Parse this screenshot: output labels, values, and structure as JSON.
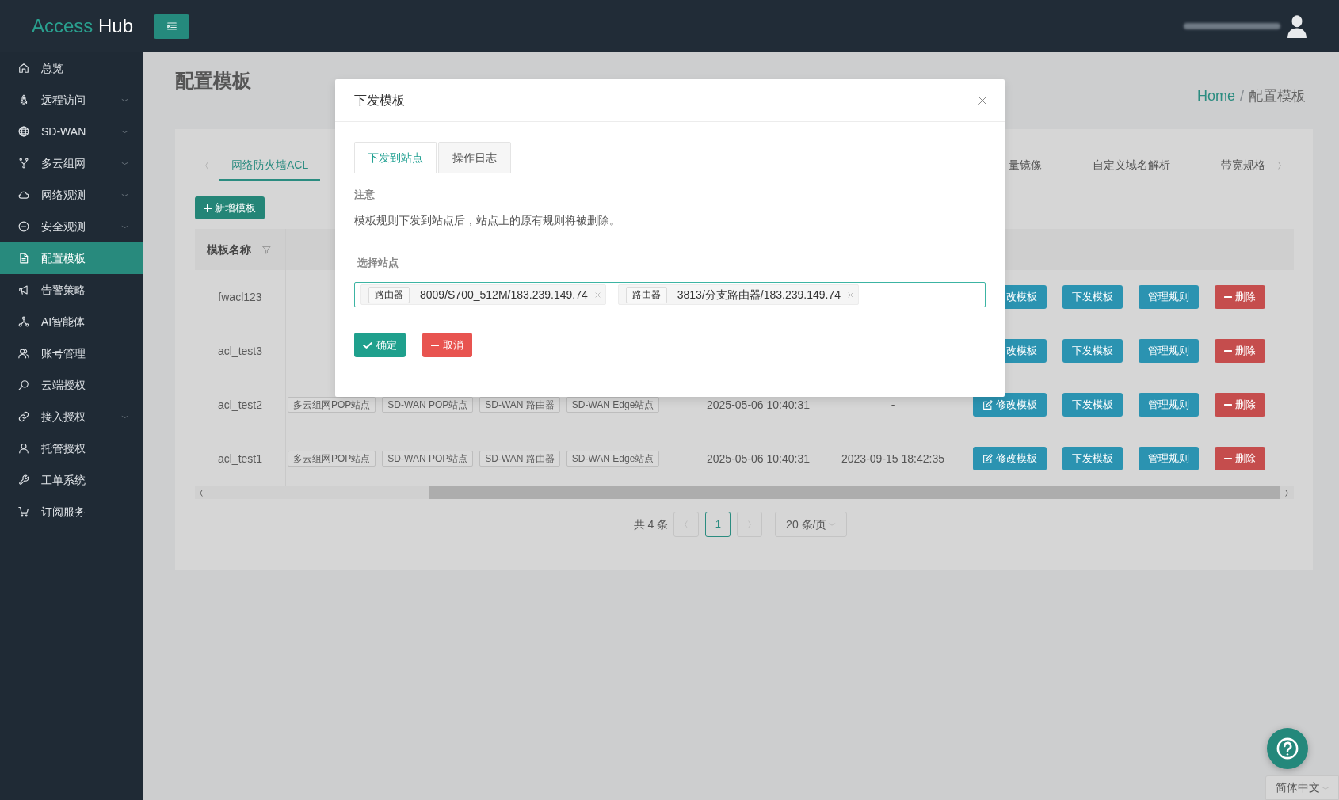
{
  "header": {
    "logo": {
      "first": "Access",
      "second": "Hub"
    }
  },
  "sidebar": {
    "items": [
      {
        "label": "总览",
        "expandable": false,
        "selected": false
      },
      {
        "label": "远程访问",
        "expandable": true,
        "selected": false
      },
      {
        "label": "SD-WAN",
        "expandable": true,
        "selected": false
      },
      {
        "label": "多云组网",
        "expandable": true,
        "selected": false
      },
      {
        "label": "网络观测",
        "expandable": true,
        "selected": false
      },
      {
        "label": "安全观测",
        "expandable": true,
        "selected": false
      },
      {
        "label": "配置模板",
        "expandable": false,
        "selected": true
      },
      {
        "label": "告警策略",
        "expandable": false,
        "selected": false
      },
      {
        "label": "AI智能体",
        "expandable": false,
        "selected": false
      },
      {
        "label": "账号管理",
        "expandable": false,
        "selected": false
      },
      {
        "label": "云端授权",
        "expandable": false,
        "selected": false
      },
      {
        "label": "接入授权",
        "expandable": true,
        "selected": false
      },
      {
        "label": "托管授权",
        "expandable": false,
        "selected": false
      },
      {
        "label": "工单系统",
        "expandable": false,
        "selected": false
      },
      {
        "label": "订阅服务",
        "expandable": false,
        "selected": false
      }
    ]
  },
  "page": {
    "title": "配置模板",
    "breadcrumb": {
      "separator": "/",
      "items": [
        {
          "label": "Home",
          "link": true
        },
        {
          "label": "配置模板",
          "link": false
        }
      ]
    }
  },
  "tabs": {
    "left": [
      {
        "label": "网络防火墙ACL",
        "selected": true
      }
    ],
    "right": [
      {
        "label": "量镜像",
        "selected": false
      },
      {
        "label": "自定义域名解析",
        "selected": false
      },
      {
        "label": "带宽规格",
        "selected": false
      }
    ]
  },
  "add_button": {
    "label": "新增模板"
  },
  "table": {
    "columns": [
      {
        "label": "模板名称",
        "filterable": true
      }
    ],
    "rows": [
      {
        "name": "fwacl123",
        "actions": [
          {
            "label": "改模板",
            "kind": "edit",
            "partial": true
          },
          {
            "label": "下发模板",
            "kind": "primary",
            "partial": false
          },
          {
            "label": "管理规则",
            "kind": "primary",
            "partial": false
          },
          {
            "label": "删除",
            "kind": "danger",
            "partial": false
          }
        ]
      },
      {
        "name": "acl_test3",
        "actions": [
          {
            "label": "改模板",
            "kind": "edit",
            "partial": true
          },
          {
            "label": "下发模板",
            "kind": "primary",
            "partial": false
          },
          {
            "label": "管理规则",
            "kind": "primary",
            "partial": false
          },
          {
            "label": "删除",
            "kind": "danger",
            "partial": false
          }
        ]
      },
      {
        "name": "acl_test2",
        "column_2": [
          "多云组网POP站点",
          "SD-WAN POP站点",
          "SD-WAN 路由器",
          "SD-WAN Edge站点"
        ],
        "column_3": "2025-05-06 10:40:31",
        "column_4": "-",
        "actions": [
          {
            "label": "修改模板",
            "kind": "edit",
            "partial": false
          },
          {
            "label": "下发模板",
            "kind": "primary",
            "partial": false
          },
          {
            "label": "管理规则",
            "kind": "primary",
            "partial": false
          },
          {
            "label": "删除",
            "kind": "danger",
            "partial": false
          }
        ]
      },
      {
        "name": "acl_test1",
        "column_2": [
          "多云组网POP站点",
          "SD-WAN POP站点",
          "SD-WAN 路由器",
          "SD-WAN Edge站点"
        ],
        "column_3": "2025-05-06 10:40:31",
        "column_4": "2023-09-15 18:42:35",
        "actions": [
          {
            "label": "修改模板",
            "kind": "edit",
            "partial": false
          },
          {
            "label": "下发模板",
            "kind": "primary",
            "partial": false
          },
          {
            "label": "管理规则",
            "kind": "primary",
            "partial": false
          },
          {
            "label": "删除",
            "kind": "danger",
            "partial": false
          }
        ]
      }
    ]
  },
  "pagination": {
    "total": "共 4 条",
    "prev": {
      "disabled": true
    },
    "pages": [
      {
        "label": "1",
        "selected": true
      }
    ],
    "next": {
      "disabled": true
    },
    "page_size": "20 条/页"
  },
  "modal": {
    "title": "下发模板",
    "tabs": [
      {
        "label": "下发到站点",
        "selected": true
      },
      {
        "label": "操作日志",
        "selected": false
      }
    ],
    "notice_label": "注意",
    "notice": "模板规则下发到站点后，站点上的原有规则将被删除。",
    "field_label": "选择站点",
    "selected_sites": [
      {
        "type": "路由器",
        "value": "8009/S700_512M/183.239.149.74"
      },
      {
        "type": "路由器",
        "value": "3813/分支路由器/183.239.149.74"
      }
    ],
    "buttons": [
      {
        "label": "确定",
        "kind": "confirm"
      },
      {
        "label": "取消",
        "kind": "cancel"
      }
    ]
  },
  "language_select": {
    "value": "简体中文"
  }
}
